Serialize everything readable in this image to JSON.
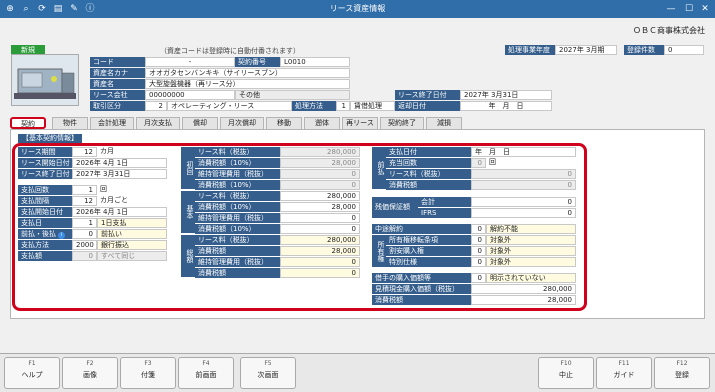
{
  "window": {
    "title": "リース資産情報"
  },
  "company": "ＯＢＣ商事株式会社",
  "header": {
    "new_label": "新規",
    "note": "（資産コードは登録時に自動付番されます）",
    "year_label": "処理事業年度",
    "year_value": "2027年 3月期",
    "reg_label": "登録件数",
    "reg_value": "0"
  },
  "asset": {
    "code_label": "コード",
    "code_value": "-",
    "contract_no_label": "契約番号",
    "contract_no_value": "L0010",
    "kana_label": "資産名カナ",
    "kana_value": "オオガタセンバンキキ（サイリースブン）",
    "name_label": "資産名",
    "name_value": "大型旋盤機器（再リース分）",
    "company_label": "リース会社",
    "company_code": "00000000",
    "company_name": "その他",
    "end_label": "リース終了日付",
    "end_value": "2027年 3月31日",
    "trade_label": "取引区分",
    "trade_code": "2",
    "trade_name": "オペレーティング・リース",
    "method_label": "処理方法",
    "method_code": "1",
    "method_name": "賃借処理",
    "return_label": "返却日付",
    "return_value": "年　月　日"
  },
  "tabs": [
    "契約",
    "物件",
    "会計処理",
    "月次支払",
    "償却",
    "月次償却",
    "移動",
    "遡体",
    "再リース",
    "契約終了",
    "減損"
  ],
  "section_title": "【基本契約情報】",
  "left": {
    "period_label": "リース期間",
    "period_value": "12",
    "period_unit": "カ月",
    "start_label": "リース開始日付",
    "start_value": "2026年 4月 1日",
    "finish_label": "リース終了日付",
    "finish_value": "2027年 3月31日",
    "count_label": "支払回数",
    "count_value": "1",
    "count_unit": "回",
    "interval_label": "支払間隔",
    "interval_value": "12",
    "interval_unit": "カ月ごと",
    "paystart_label": "支払開始日付",
    "paystart_value": "2026年 4月 1日",
    "payday_label": "支払日",
    "payday_value": "1",
    "payday_name": "1日支払",
    "prepay_label": "前払・後払",
    "prepay_value": "0",
    "prepay_name": "前払い",
    "paymethod_label": "支払方法",
    "paymethod_value": "2000",
    "paymethod_name": "銀行振込",
    "payamount_label": "支払額",
    "payamount_value": "0",
    "payamount_name": "すべて同じ"
  },
  "middle": {
    "group_first": "初回",
    "group_basic": "基本",
    "group_total": "総額",
    "rows_first": [
      {
        "label": "リース料（税抜）",
        "value": "280,000"
      },
      {
        "label": "消費税額（10%）",
        "value": "28,000"
      },
      {
        "label": "維持管理費用（税抜）",
        "value": "0"
      },
      {
        "label": "消費税額（10%）",
        "value": "0"
      }
    ],
    "rows_basic": [
      {
        "label": "リース料（税抜）",
        "value": "280,000"
      },
      {
        "label": "消費税額（10%）",
        "value": "28,000"
      },
      {
        "label": "維持管理費用（税抜）",
        "value": "0"
      },
      {
        "label": "消費税額（10%）",
        "value": "0"
      }
    ],
    "rows_total": [
      {
        "label": "リース料（税抜）",
        "value": "280,000"
      },
      {
        "label": "消費税額",
        "value": "28,000"
      },
      {
        "label": "維持管理費用（税抜）",
        "value": "0"
      },
      {
        "label": "消費税額",
        "value": "0"
      }
    ]
  },
  "right": {
    "group_prepay": "前払",
    "paydate_label": "支払日付",
    "paydate_value": "年　月　日",
    "paycount_label": "充当回数",
    "paycount_value": "0",
    "paycount_unit": "回",
    "fee_label": "リース料（税抜）",
    "fee_value": "0",
    "tax_label": "消費税額",
    "tax_value": "0",
    "residual_label": "残価保証額",
    "accounting_label": "会計",
    "accounting_value": "0",
    "ifrs_label": "IFRS",
    "ifrs_value": "0",
    "cancel_label": "中途解約",
    "cancel_value": "0",
    "cancel_name": "解約不能",
    "group_owner": "所有権",
    "owner_rows": [
      {
        "label": "所有権移転条項",
        "value": "0",
        "name": "対象外"
      },
      {
        "label": "割安購入権",
        "value": "0",
        "name": "対象外"
      },
      {
        "label": "特別仕様",
        "value": "0",
        "name": "対象外"
      }
    ],
    "buy_label": "借手の購入価額等",
    "buy_value": "0",
    "buy_name": "明示されていない",
    "est_label": "見積現金購入価額（税抜）",
    "est_value": "280,000",
    "esttax_label": "消費税額",
    "esttax_value": "28,000"
  },
  "fkeys": [
    {
      "key": "F1",
      "label": "ヘルプ"
    },
    {
      "key": "F2",
      "label": "画像"
    },
    {
      "key": "F3",
      "label": "付箋"
    },
    {
      "key": "F4",
      "label": "前画面"
    },
    {
      "key": "F5",
      "label": "次画面"
    },
    {
      "key": "F10",
      "label": "中止"
    },
    {
      "key": "F11",
      "label": "ガイド"
    },
    {
      "key": "F12",
      "label": "登録"
    }
  ]
}
